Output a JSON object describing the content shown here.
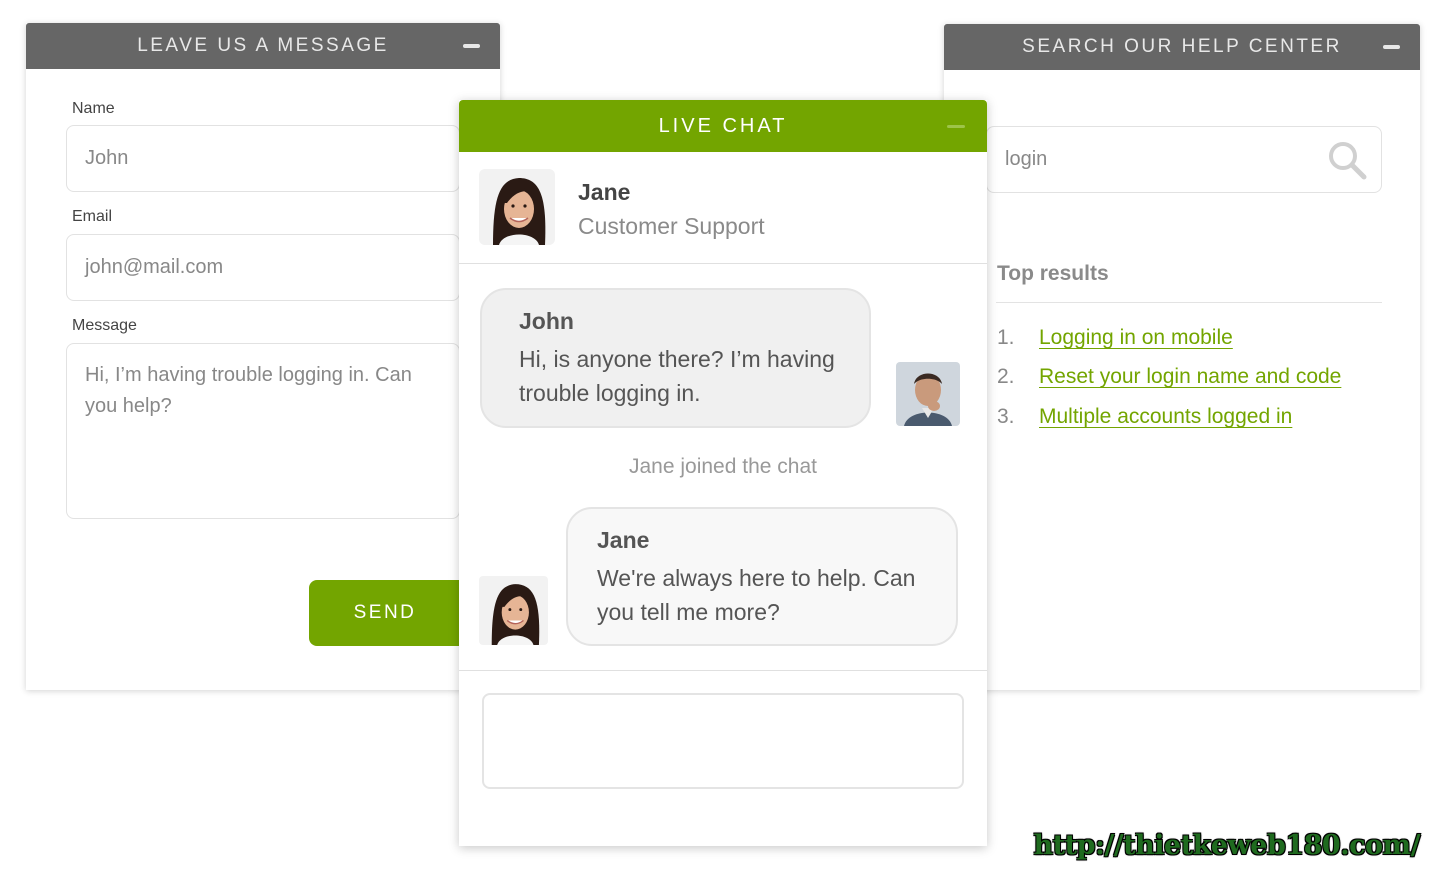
{
  "colors": {
    "accent": "#73a500",
    "header_gray": "#666666"
  },
  "message_panel": {
    "title": "LEAVE US A MESSAGE",
    "name_label": "Name",
    "name_value": "John",
    "email_label": "Email",
    "email_value": "john@mail.com",
    "message_label": "Message",
    "message_value": "Hi, I’m having trouble logging in. Can you help?",
    "send_label": "SEND"
  },
  "chat": {
    "title": "LIVE CHAT",
    "agent_name": "Jane",
    "agent_role": "Customer Support",
    "messages": [
      {
        "sender": "John",
        "text": "Hi, is anyone there? I’m having trouble logging in."
      },
      {
        "sender": "Jane",
        "text": "We're always here to help. Can you tell me more?"
      }
    ],
    "join_notice": "Jane joined the chat"
  },
  "help_panel": {
    "title": "SEARCH OUR HELP CENTER",
    "search_value": "login",
    "top_results_heading": "Top results",
    "results": [
      {
        "num": "1.",
        "label": "Logging in on mobile"
      },
      {
        "num": "2.",
        "label": "Reset your login name and code"
      },
      {
        "num": "3.",
        "label": "Multiple accounts logged in"
      }
    ]
  },
  "watermark": "http://thietkeweb180.com/"
}
